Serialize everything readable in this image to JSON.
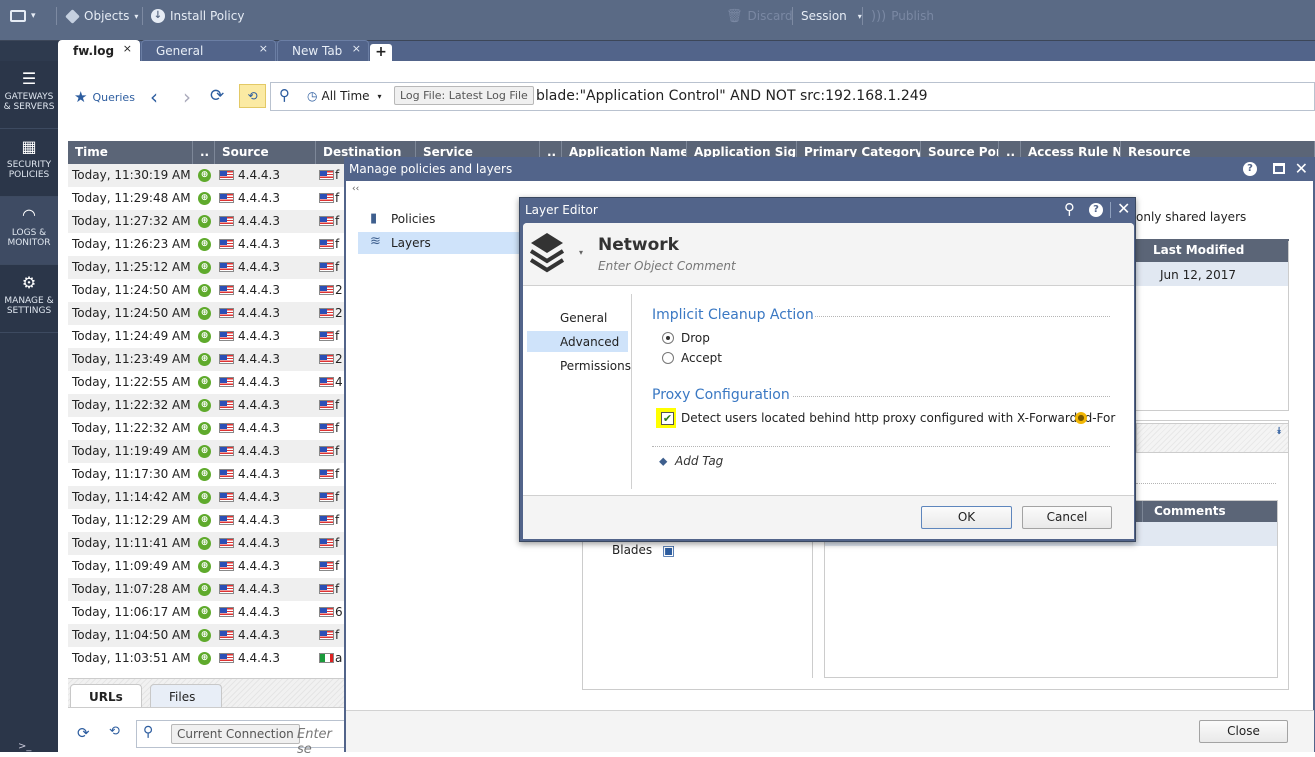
{
  "topbar": {
    "menu_dropdown": "▾",
    "objects_label": "Objects",
    "install_policy_label": "Install Policy",
    "discard_label": "Discard",
    "session_label": "Session",
    "publish_label": "Publish"
  },
  "tabs": [
    {
      "label": "fw.log",
      "active": true
    },
    {
      "label": "General Overview",
      "active": false
    },
    {
      "label": "New Tab",
      "active": false
    }
  ],
  "new_tab_label": "+",
  "close_glyph": "×",
  "leftnav": [
    {
      "label1": "GATEWAYS",
      "label2": "& SERVERS",
      "icon": "server-icon"
    },
    {
      "label1": "SECURITY",
      "label2": "POLICIES",
      "icon": "grid-icon"
    },
    {
      "label1": "LOGS &",
      "label2": "MONITOR",
      "icon": "gauge-icon",
      "active": true
    },
    {
      "label1": "MANAGE &",
      "label2": "SETTINGS",
      "icon": "gear-icon"
    }
  ],
  "querybar": {
    "queries_label": "Queries",
    "time_filter": "All Time",
    "log_file_chip": "Log File: Latest Log File",
    "query_text": "blade:\"Application Control\"  AND NOT src:192.168.1.249"
  },
  "table": {
    "columns": [
      "Time",
      "..",
      "Source",
      "Destination",
      "Service",
      "..",
      "Application Name",
      "Application Sig...",
      "Primary Category",
      "Source Port",
      "..",
      "Access Rule N...",
      "Resource"
    ],
    "rows": [
      {
        "time": "Today, 11:30:19 AM",
        "source": "4.4.4.3",
        "dest": "f",
        "flag": "us"
      },
      {
        "time": "Today, 11:29:48 AM",
        "source": "4.4.4.3",
        "dest": "f",
        "flag": "us"
      },
      {
        "time": "Today, 11:27:32 AM",
        "source": "4.4.4.3",
        "dest": "f",
        "flag": "us"
      },
      {
        "time": "Today, 11:26:23 AM",
        "source": "4.4.4.3",
        "dest": "f",
        "flag": "us"
      },
      {
        "time": "Today, 11:25:12 AM",
        "source": "4.4.4.3",
        "dest": "f",
        "flag": "us"
      },
      {
        "time": "Today, 11:24:50 AM",
        "source": "4.4.4.3",
        "dest": "2",
        "flag": "us"
      },
      {
        "time": "Today, 11:24:50 AM",
        "source": "4.4.4.3",
        "dest": "2",
        "flag": "us"
      },
      {
        "time": "Today, 11:24:49 AM",
        "source": "4.4.4.3",
        "dest": "f",
        "flag": "us"
      },
      {
        "time": "Today, 11:23:49 AM",
        "source": "4.4.4.3",
        "dest": "2",
        "flag": "us"
      },
      {
        "time": "Today, 11:22:55 AM",
        "source": "4.4.4.3",
        "dest": "4",
        "flag": "us"
      },
      {
        "time": "Today, 11:22:32 AM",
        "source": "4.4.4.3",
        "dest": "f",
        "flag": "us"
      },
      {
        "time": "Today, 11:22:32 AM",
        "source": "4.4.4.3",
        "dest": "f",
        "flag": "us"
      },
      {
        "time": "Today, 11:19:49 AM",
        "source": "4.4.4.3",
        "dest": "f",
        "flag": "us"
      },
      {
        "time": "Today, 11:17:30 AM",
        "source": "4.4.4.3",
        "dest": "f",
        "flag": "us"
      },
      {
        "time": "Today, 11:14:42 AM",
        "source": "4.4.4.3",
        "dest": "f",
        "flag": "us"
      },
      {
        "time": "Today, 11:12:29 AM",
        "source": "4.4.4.3",
        "dest": "f",
        "flag": "us"
      },
      {
        "time": "Today, 11:11:41 AM",
        "source": "4.4.4.3",
        "dest": "f",
        "flag": "us"
      },
      {
        "time": "Today, 11:09:49 AM",
        "source": "4.4.4.3",
        "dest": "f",
        "flag": "us"
      },
      {
        "time": "Today, 11:07:28 AM",
        "source": "4.4.4.3",
        "dest": "f",
        "flag": "us"
      },
      {
        "time": "Today, 11:06:17 AM",
        "source": "4.4.4.3",
        "dest": "6",
        "flag": "us"
      },
      {
        "time": "Today, 11:04:50 AM",
        "source": "4.4.4.3",
        "dest": "f",
        "flag": "us"
      },
      {
        "time": "Today, 11:03:51 AM",
        "source": "4.4.4.3",
        "dest": "a",
        "flag": "it"
      }
    ]
  },
  "bottom_panel": {
    "tabs": [
      "URLs",
      "Files"
    ],
    "chip": "Current Connection",
    "placeholder": "Enter se"
  },
  "manage_dialog": {
    "title": "Manage policies and layers",
    "collapse": "‹‹",
    "nav": [
      {
        "label": "Policies",
        "selected": false
      },
      {
        "label": "Layers",
        "selected": true
      }
    ],
    "filter_text": "only shared layers",
    "grid_header_last_modified": "Last Modified",
    "grid_row_last_modified": "Jun 12, 2017",
    "details_blades_label": "Blades",
    "comments_header": "Comments",
    "close_label": "Close"
  },
  "layer_editor": {
    "title": "Layer Editor",
    "name": "Network",
    "comment_placeholder": "Enter Object Comment",
    "nav": [
      {
        "label": "General",
        "selected": false
      },
      {
        "label": "Advanced",
        "selected": true
      },
      {
        "label": "Permissions",
        "selected": false
      }
    ],
    "implicit_cleanup": {
      "heading": "Implicit Cleanup Action",
      "options": [
        {
          "label": "Drop",
          "selected": true
        },
        {
          "label": "Accept",
          "selected": false
        }
      ]
    },
    "proxy": {
      "heading": "Proxy Configuration",
      "checkbox_label": "Detect users located behind http proxy configured with X-Forwarded-For",
      "checked": true
    },
    "add_tag_label": "Add Tag",
    "ok_label": "OK",
    "cancel_label": "Cancel"
  },
  "colors": {
    "title_bar": "#52648a",
    "accent_blue": "#3a78c3",
    "highlight_yellow": "#ffff00",
    "selected_row": "#cfe3fa"
  }
}
